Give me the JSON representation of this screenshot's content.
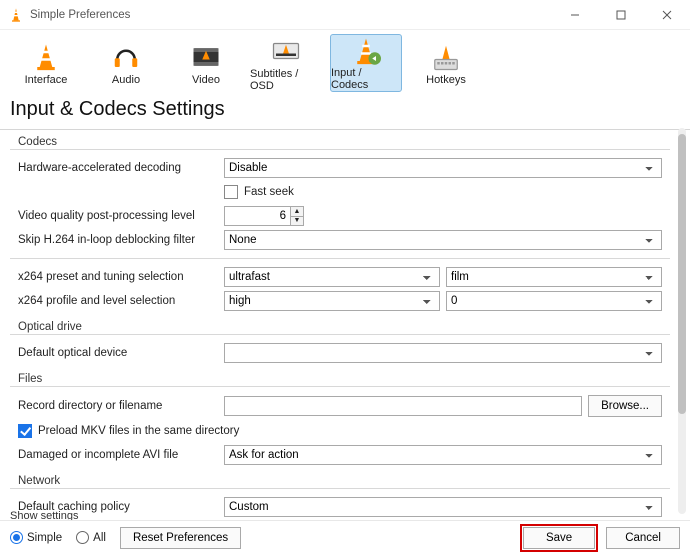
{
  "window": {
    "title": "Simple Preferences"
  },
  "tabs": [
    {
      "label": "Interface"
    },
    {
      "label": "Audio"
    },
    {
      "label": "Video"
    },
    {
      "label": "Subtitles / OSD"
    },
    {
      "label": "Input / Codecs"
    },
    {
      "label": "Hotkeys"
    }
  ],
  "page_title": "Input & Codecs Settings",
  "codecs": {
    "group": "Codecs",
    "hw_decode_label": "Hardware-accelerated decoding",
    "hw_decode_value": "Disable",
    "fast_seek_label": "Fast seek",
    "fast_seek_checked": false,
    "vq_label": "Video quality post-processing level",
    "vq_value": "6",
    "skip_label": "Skip H.264 in-loop deblocking filter",
    "skip_value": "None",
    "x264_preset_label": "x264 preset and tuning selection",
    "x264_preset_value": "ultrafast",
    "x264_tuning_value": "film",
    "x264_profile_label": "x264 profile and level selection",
    "x264_profile_value": "high",
    "x264_level_value": "0"
  },
  "optical": {
    "group": "Optical drive",
    "default_label": "Default optical device",
    "default_value": ""
  },
  "files": {
    "group": "Files",
    "record_label": "Record directory or filename",
    "record_value": "",
    "browse": "Browse...",
    "preload_label": "Preload MKV files in the same directory",
    "preload_checked": true,
    "avi_label": "Damaged or incomplete AVI file",
    "avi_value": "Ask for action"
  },
  "network": {
    "group": "Network",
    "cache_label": "Default caching policy",
    "cache_value": "Custom"
  },
  "footer": {
    "show_settings": "Show settings",
    "simple": "Simple",
    "all": "All",
    "reset": "Reset Preferences",
    "save": "Save",
    "cancel": "Cancel"
  }
}
